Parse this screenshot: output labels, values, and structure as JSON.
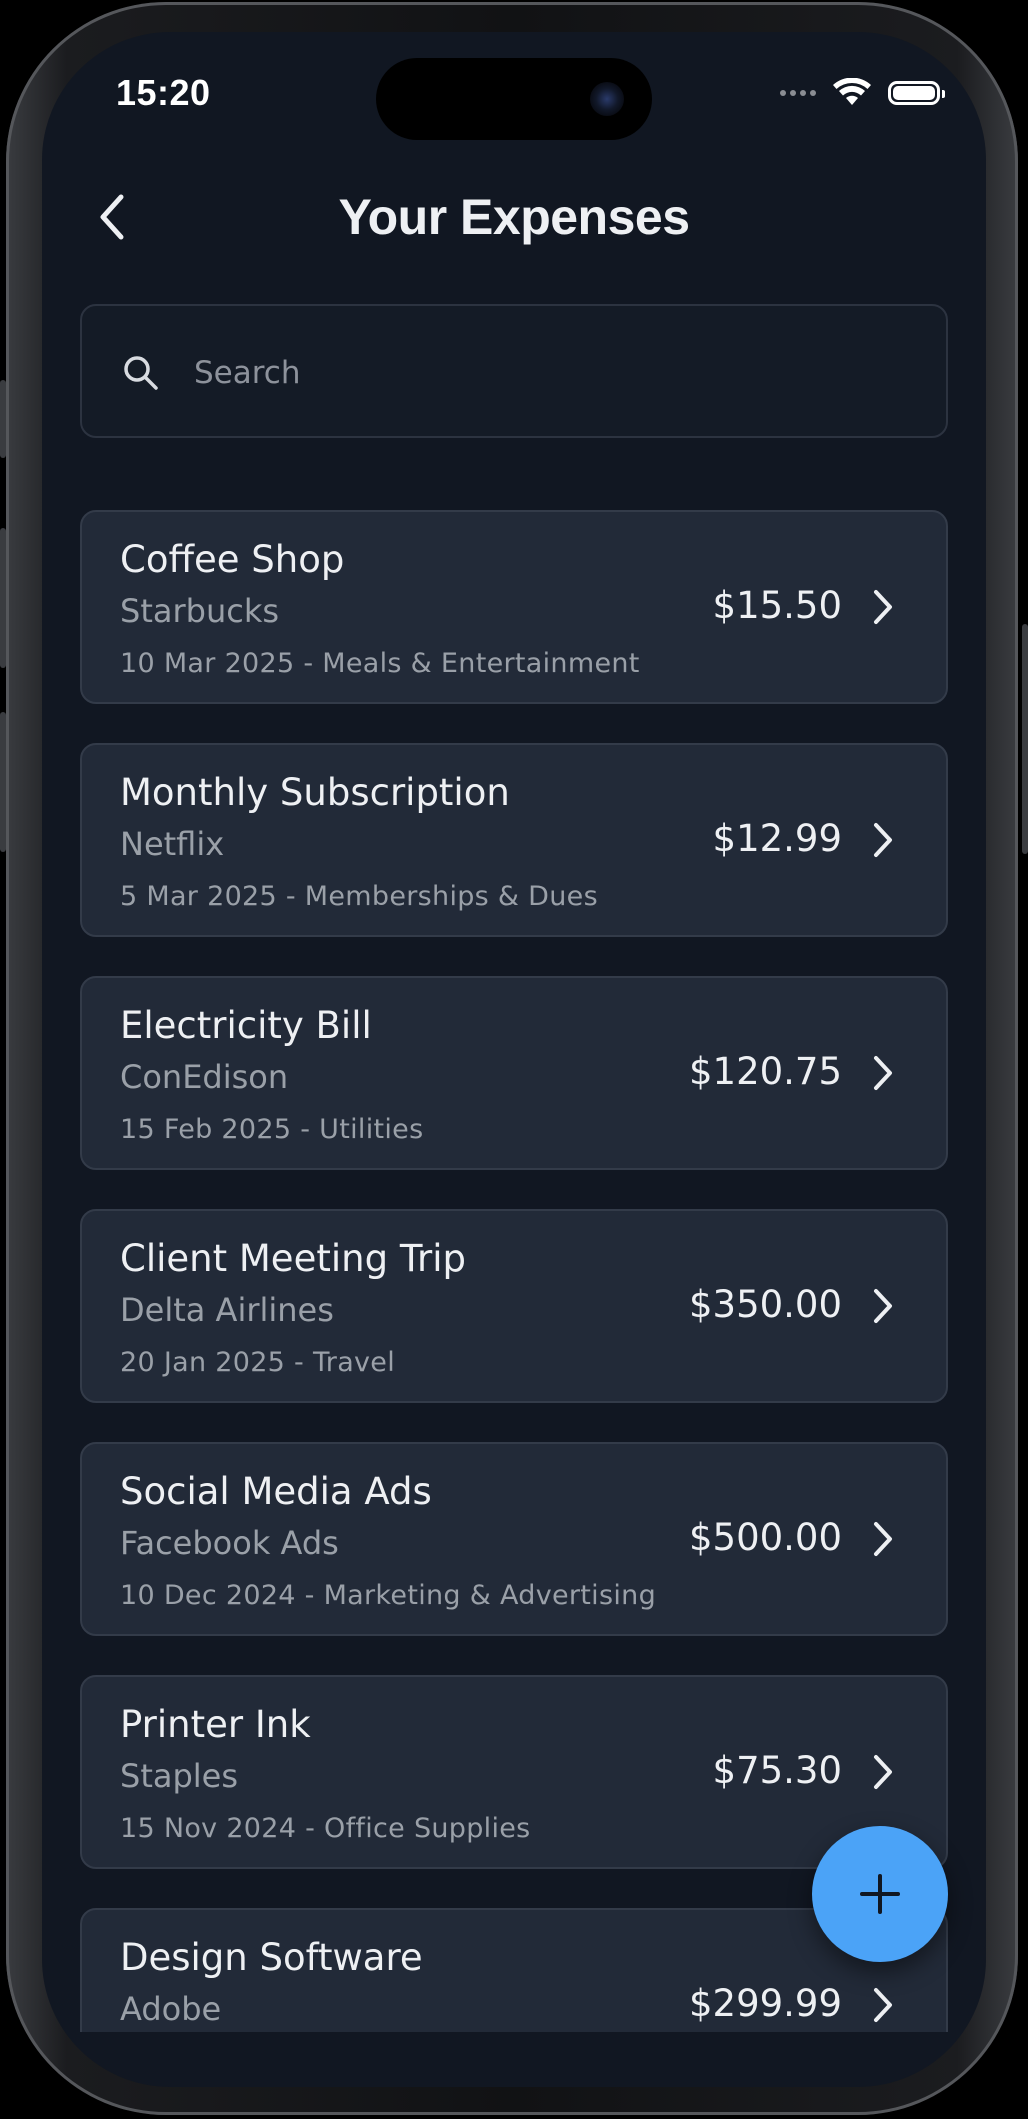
{
  "status_bar": {
    "time": "15:20",
    "icons": [
      "signal-dots-icon",
      "wifi-icon",
      "battery-icon"
    ]
  },
  "header": {
    "title": "Your Expenses",
    "back_icon": "chevron-left-icon"
  },
  "search": {
    "placeholder": "Search",
    "value": "",
    "icon": "search-icon"
  },
  "expenses": [
    {
      "title": "Coffee Shop",
      "vendor": "Starbucks",
      "meta": "10 Mar 2025 - Meals & Entertainment",
      "amount": "$15.50"
    },
    {
      "title": "Monthly Subscription",
      "vendor": "Netflix",
      "meta": "5 Mar 2025 - Memberships & Dues",
      "amount": "$12.99"
    },
    {
      "title": "Electricity Bill",
      "vendor": "ConEdison",
      "meta": "15 Feb 2025 - Utilities",
      "amount": "$120.75"
    },
    {
      "title": "Client Meeting Trip",
      "vendor": "Delta Airlines",
      "meta": "20 Jan 2025 - Travel",
      "amount": "$350.00"
    },
    {
      "title": "Social Media Ads",
      "vendor": "Facebook Ads",
      "meta": "10 Dec 2024 - Marketing & Advertising",
      "amount": "$500.00"
    },
    {
      "title": "Printer Ink",
      "vendor": "Staples",
      "meta": "15 Nov 2024 - Office Supplies",
      "amount": "$75.30"
    },
    {
      "title": "Design Software",
      "vendor": "Adobe",
      "meta": "",
      "amount": "$299.99"
    }
  ],
  "fab": {
    "icon": "plus-icon"
  },
  "colors": {
    "background": "#111722",
    "card": "#222a38",
    "accent": "#4ba3f7",
    "text_primary": "#eef0f3",
    "text_secondary": "#9aa0a8"
  }
}
